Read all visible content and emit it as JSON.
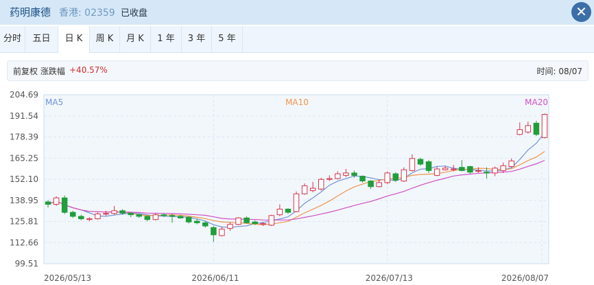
{
  "header": {
    "name": "药明康德",
    "market": "香港: 02359",
    "status": "已收盘",
    "close_icon": "close-icon"
  },
  "tabs": [
    {
      "label": "分时",
      "active": false
    },
    {
      "label": "五日",
      "active": false
    },
    {
      "label": "日 K",
      "active": true
    },
    {
      "label": "周 K",
      "active": false
    },
    {
      "label": "月 K",
      "active": false
    },
    {
      "label": "1 年",
      "active": false
    },
    {
      "label": "3 年",
      "active": false
    },
    {
      "label": "5 年",
      "active": false
    }
  ],
  "info": {
    "adjust": "前复权 涨跌幅",
    "change": "+40.57%",
    "time": "时间: 08/07"
  },
  "colors": {
    "up": "#d6334a",
    "down": "#1f9e3a",
    "ma5": "#6f93d6",
    "ma10": "#f0944a",
    "ma20": "#d24fc8"
  },
  "chart_data": {
    "type": "candlestick",
    "ylim": [
      99.51,
      204.69
    ],
    "y_ticks": [
      "204.69",
      "191.54",
      "178.39",
      "165.25",
      "152.10",
      "138.95",
      "125.81",
      "112.66",
      "99.51"
    ],
    "x_ticks": [
      "2026/05/13",
      "2026/06/11",
      "2026/07/13",
      "2026/08/07"
    ],
    "legend": [
      "MA5",
      "MA10",
      "MA20"
    ],
    "candles": [
      [
        138.0,
        136.5,
        139.2,
        134.5
      ],
      [
        136.5,
        140.5,
        141.5,
        135.5
      ],
      [
        140.5,
        131.5,
        142.0,
        130.5
      ],
      [
        131.5,
        129.0,
        132.5,
        128.0
      ],
      [
        129.0,
        127.5,
        130.0,
        126.5
      ],
      [
        127.0,
        127.5,
        128.5,
        126.0
      ],
      [
        127.5,
        130.5,
        131.5,
        127.0
      ],
      [
        130.5,
        130.8,
        132.5,
        129.5
      ],
      [
        130.8,
        132.5,
        135.5,
        130.0
      ],
      [
        132.5,
        131.0,
        133.5,
        130.0
      ],
      [
        131.0,
        130.0,
        131.5,
        128.5
      ],
      [
        130.0,
        129.0,
        130.5,
        128.0
      ],
      [
        129.0,
        127.0,
        129.5,
        126.0
      ],
      [
        127.0,
        130.0,
        131.0,
        126.5
      ],
      [
        130.0,
        129.5,
        131.0,
        128.5
      ],
      [
        129.5,
        129.0,
        130.5,
        125.0
      ],
      [
        129.0,
        128.0,
        130.0,
        127.5
      ],
      [
        128.5,
        125.5,
        129.0,
        124.5
      ],
      [
        126.0,
        125.0,
        127.5,
        124.0
      ],
      [
        125.0,
        123.0,
        126.0,
        122.0
      ],
      [
        122.0,
        117.5,
        123.0,
        113.0
      ],
      [
        117.0,
        121.0,
        122.5,
        116.5
      ],
      [
        121.5,
        124.0,
        125.5,
        120.0
      ],
      [
        124.0,
        128.0,
        128.5,
        123.5
      ],
      [
        128.0,
        125.0,
        129.0,
        124.5
      ],
      [
        125.5,
        124.5,
        126.5,
        123.5
      ],
      [
        124.0,
        124.5,
        125.5,
        123.0
      ],
      [
        123.5,
        129.5,
        130.0,
        123.0
      ],
      [
        130.0,
        133.5,
        136.5,
        129.0
      ],
      [
        133.5,
        131.5,
        134.0,
        130.5
      ],
      [
        132.0,
        143.0,
        144.5,
        131.5
      ],
      [
        143.0,
        148.0,
        149.5,
        142.5
      ],
      [
        145.0,
        146.5,
        150.5,
        144.0
      ],
      [
        146.0,
        152.0,
        153.0,
        145.0
      ],
      [
        152.0,
        152.5,
        154.5,
        151.0
      ],
      [
        152.5,
        155.5,
        157.0,
        152.0
      ],
      [
        154.5,
        156.0,
        158.5,
        153.5
      ],
      [
        156.0,
        154.5,
        157.5,
        153.0
      ],
      [
        154.0,
        151.0,
        154.5,
        150.0
      ],
      [
        151.0,
        147.5,
        151.5,
        146.0
      ],
      [
        147.5,
        150.0,
        152.0,
        147.0
      ],
      [
        150.0,
        156.0,
        157.0,
        149.0
      ],
      [
        155.5,
        151.5,
        156.5,
        150.5
      ],
      [
        151.0,
        158.0,
        159.5,
        150.5
      ],
      [
        157.5,
        165.0,
        167.5,
        157.0
      ],
      [
        164.5,
        161.5,
        165.5,
        160.5
      ],
      [
        163.0,
        157.5,
        164.0,
        156.0
      ],
      [
        154.5,
        158.5,
        160.0,
        154.0
      ],
      [
        158.0,
        159.0,
        160.5,
        157.5
      ],
      [
        158.0,
        158.5,
        161.0,
        157.0
      ],
      [
        159.5,
        157.5,
        164.0,
        157.0
      ],
      [
        160.0,
        156.5,
        160.5,
        155.5
      ],
      [
        157.0,
        157.5,
        159.5,
        156.0
      ],
      [
        156.5,
        156.0,
        159.5,
        152.5
      ],
      [
        156.0,
        159.0,
        160.0,
        154.0
      ],
      [
        157.5,
        160.5,
        162.5,
        156.0
      ],
      [
        160.0,
        163.5,
        165.0,
        159.5
      ],
      [
        180.0,
        183.0,
        187.5,
        179.5
      ],
      [
        181.5,
        185.5,
        188.0,
        180.5
      ],
      [
        187.0,
        180.0,
        188.5,
        179.0
      ],
      [
        178.0,
        192.5,
        193.0,
        177.5
      ]
    ]
  }
}
